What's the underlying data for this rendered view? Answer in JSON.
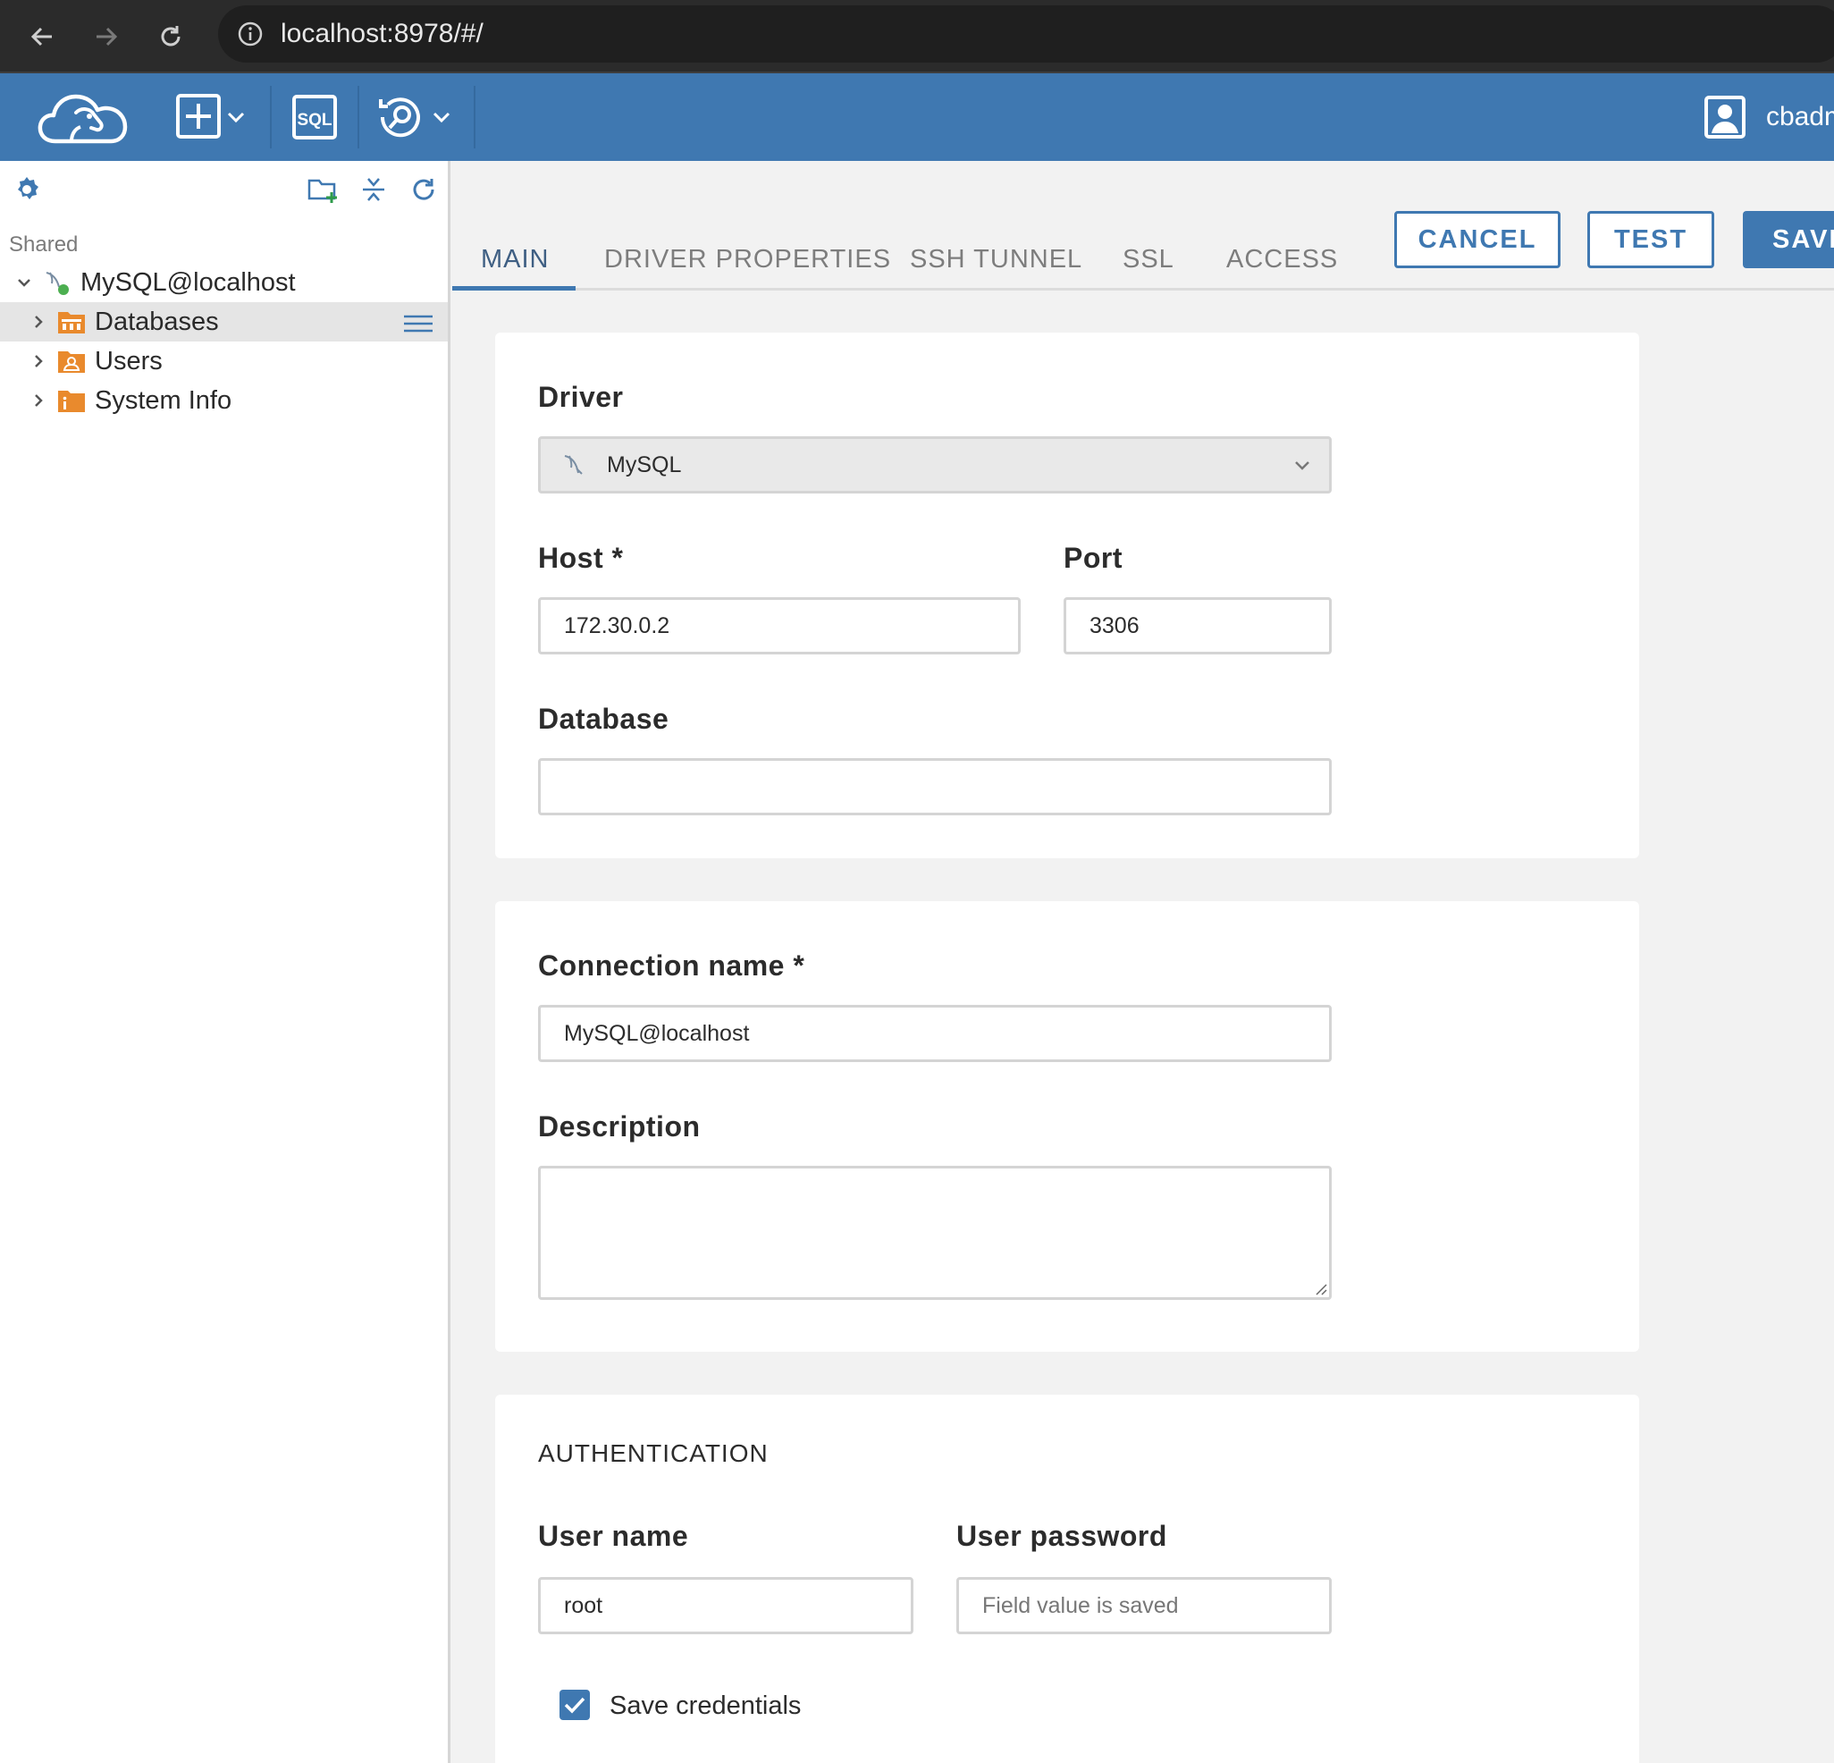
{
  "browser": {
    "url": "localhost:8978/#/",
    "icons": [
      "back-arrow-icon",
      "forward-arrow-icon",
      "reload-icon",
      "info-icon"
    ]
  },
  "header": {
    "user_name": "cbadm",
    "icons": [
      "dbeaver-logo",
      "new-connection-icon",
      "sql-editor-icon",
      "tools-icon",
      "user-icon"
    ],
    "brand_color": "#3f78b1"
  },
  "sidebar": {
    "group_label": "Shared",
    "connection": {
      "label": "MySQL@localhost",
      "status_color": "#4caf50"
    },
    "items": [
      {
        "label": "Databases"
      },
      {
        "label": "Users"
      },
      {
        "label": "System Info"
      }
    ],
    "tool_icons": [
      "settings-gear-icon",
      "new-folder-icon",
      "collapse-all-icon",
      "refresh-icon"
    ]
  },
  "tabs": [
    {
      "label": "MAIN",
      "active": true
    },
    {
      "label": "DRIVER PROPERTIES",
      "active": false
    },
    {
      "label": "SSH TUNNEL",
      "active": false
    },
    {
      "label": "SSL",
      "active": false
    },
    {
      "label": "ACCESS",
      "active": false
    }
  ],
  "actions": {
    "cancel": "CANCEL",
    "test": "TEST",
    "save": "SAVE"
  },
  "form": {
    "driver": {
      "label": "Driver",
      "value": "MySQL"
    },
    "host": {
      "label": "Host *",
      "value": "172.30.0.2"
    },
    "port": {
      "label": "Port",
      "value": "3306"
    },
    "database": {
      "label": "Database",
      "value": ""
    },
    "connection_name": {
      "label": "Connection name *",
      "value": "MySQL@localhost"
    },
    "description": {
      "label": "Description",
      "value": ""
    },
    "auth_title": "AUTHENTICATION",
    "user_name": {
      "label": "User name",
      "value": "root"
    },
    "user_password": {
      "label": "User password",
      "placeholder": "Field value is saved"
    },
    "save_credentials": {
      "label": "Save credentials",
      "checked": true
    }
  }
}
